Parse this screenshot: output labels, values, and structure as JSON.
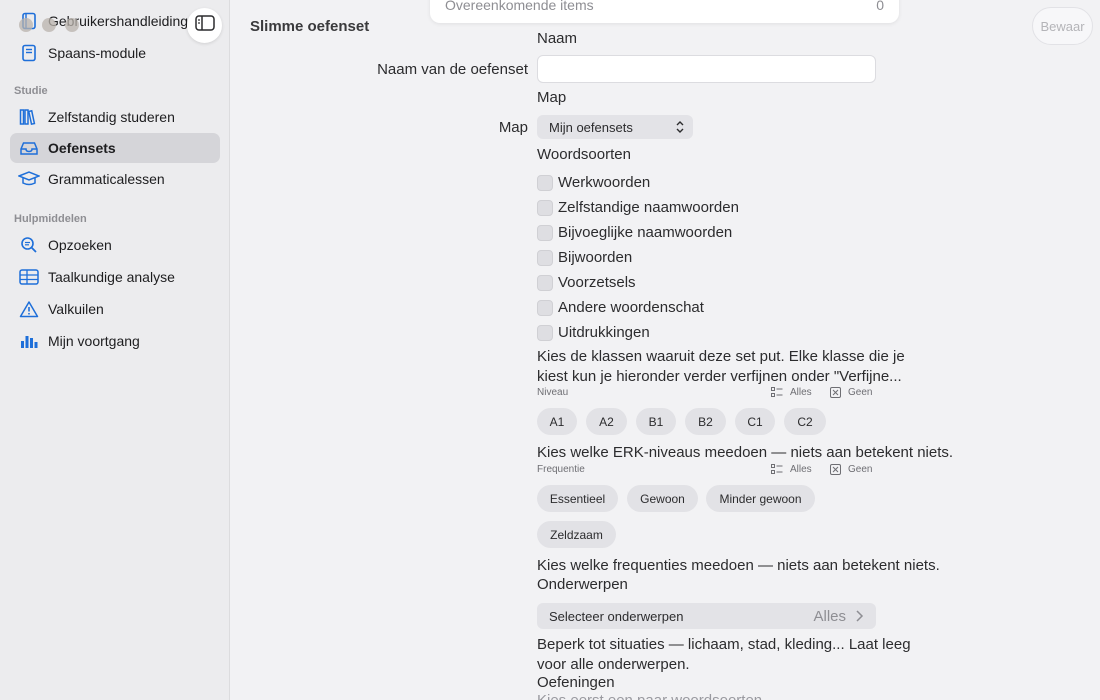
{
  "sidebar": {
    "items_top": [
      {
        "label": "Gebruikershandleiding",
        "icon": "book-icon"
      },
      {
        "label": "Spaans-module",
        "icon": "notebook-icon"
      }
    ],
    "section_study": "Studie",
    "items_study": [
      {
        "label": "Zelfstandig studeren",
        "icon": "books-icon"
      },
      {
        "label": "Oefensets",
        "icon": "tray-icon"
      },
      {
        "label": "Grammaticalessen",
        "icon": "graduation-cap-icon"
      }
    ],
    "section_tools": "Hulpmiddelen",
    "items_tools": [
      {
        "label": "Opzoeken",
        "icon": "magnifier-icon"
      },
      {
        "label": "Taalkundige analyse",
        "icon": "table-icon"
      },
      {
        "label": "Valkuilen",
        "icon": "warning-icon"
      },
      {
        "label": "Mijn voortgang",
        "icon": "bar-chart-icon"
      }
    ],
    "accent": "#1e6fd9"
  },
  "main": {
    "title": "Slimme oefenset",
    "match_label": "Overeenkomende items",
    "match_count": "0",
    "save_label": "Bewaar",
    "name_section": "Naam",
    "name_label": "Naam van de oefenset",
    "name_value": "",
    "folder_section": "Map",
    "folder_label": "Map",
    "folder_value": "Mijn oefensets",
    "pos_section": "Woordsoorten",
    "pos_options": [
      "Werkwoorden",
      "Zelfstandige naamwoorden",
      "Bijvoeglijke naamwoorden",
      "Bijwoorden",
      "Voorzetsels",
      "Andere woordenschat",
      "Uitdrukkingen"
    ],
    "pos_desc_1": "Kies de klassen waaruit deze set put. Elke klasse die je",
    "pos_desc_2": "kiest kun je hieronder verder verfijnen onder \"Verfijne...",
    "level_section": "Niveau",
    "all_label": "Alles",
    "none_label": "Geen",
    "levels": [
      "A1",
      "A2",
      "B1",
      "B2",
      "C1",
      "C2"
    ],
    "level_desc": "Kies welke ERK-niveaus meedoen — niets aan betekent niets.",
    "freq_section": "Frequentie",
    "frequencies": [
      "Essentieel",
      "Gewoon",
      "Minder gewoon",
      "Zeldzaam"
    ],
    "freq_desc": "Kies welke frequenties meedoen — niets aan betekent niets.",
    "topics_section": "Onderwerpen",
    "topics_button": "Selecteer onderwerpen",
    "topics_value": "Alles",
    "topics_desc_1": "Beperk tot situaties — lichaam, stad, kleding... Laat leeg",
    "topics_desc_2": "voor alle onderwerpen.",
    "exercises_section": "Oefeningen",
    "exercises_desc": "Kies eerst een paar woordsoorten"
  }
}
